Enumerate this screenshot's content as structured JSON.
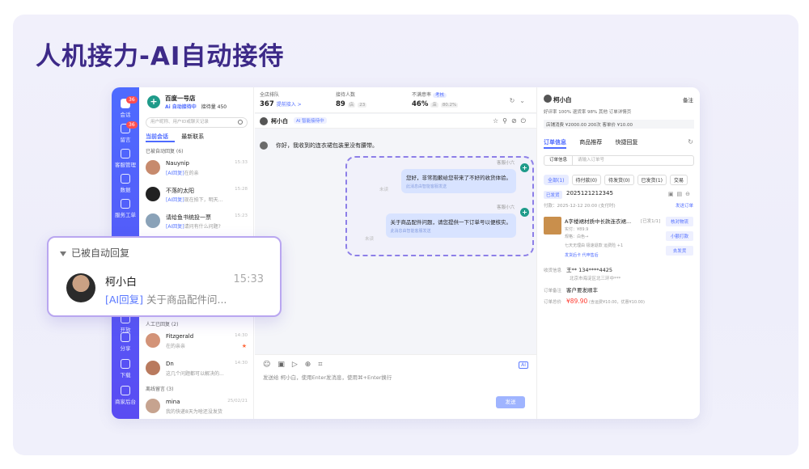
{
  "headline": "人机接力-AI自动接待",
  "rail": [
    {
      "label": "会话",
      "badge": "36",
      "icon": "chat-icon",
      "active": true
    },
    {
      "label": "留言",
      "badge": "36",
      "icon": "message-icon"
    },
    {
      "label": "客服管理",
      "icon": "agent-icon"
    },
    {
      "label": "数据",
      "icon": "chart-icon"
    },
    {
      "label": "服务工单",
      "icon": "ticket-icon"
    },
    {
      "label": "开放",
      "icon": "open-icon"
    },
    {
      "label": "分享",
      "icon": "share-icon"
    },
    {
      "label": "下载",
      "icon": "download-icon"
    },
    {
      "label": "商家后台",
      "icon": "home-icon"
    }
  ],
  "shop": {
    "name": "百度一号店",
    "ai_status": "Ai 自动接待中",
    "reception_label": "接待量",
    "reception_count": "450"
  },
  "list": {
    "search_placeholder": "用户昵称、用户ID或聊天记录",
    "tabs": [
      "当前会话",
      "最新联系"
    ],
    "group_auto": "已被自动回复 (6)",
    "group_manual": "人工已回复 (2)",
    "group_offline": "离线留言 (3)",
    "auto_items": [
      {
        "name": "Nauynip",
        "tag": "[AI回复]",
        "msg": "在的亲",
        "time": "15:33"
      },
      {
        "name": "不落的太阳",
        "tag": "[AI回复]",
        "msg": "现在拍下，明天...",
        "time": "15:28"
      },
      {
        "name": "请给鱼书统投一票",
        "tag": "[AI回复]",
        "msg": "请问有什么问题?",
        "time": "15:23"
      }
    ],
    "manual_items": [
      {
        "name": "Fitzgerald",
        "msg": "在的亲亲",
        "time": "14:30"
      },
      {
        "name": "Dn",
        "msg": "这几个问题都可以解决的...",
        "time": "14:30"
      }
    ],
    "offline_items": [
      {
        "name": "mina",
        "msg": "我的快递8天为啥还没发货",
        "time": "25/02/21"
      }
    ]
  },
  "stats": {
    "queue": {
      "label": "全店排队",
      "value": "367",
      "link": "提前接入 >"
    },
    "served": {
      "label": "接待人数",
      "value": "89",
      "sub1": "店",
      "sub2": "23"
    },
    "dissatisfied": {
      "label": "不满意率",
      "tag": "考核",
      "value": "46%",
      "sub1": "店",
      "sub2": "80.2%"
    }
  },
  "chat": {
    "customer_name": "柯小白",
    "ai_tag": "AI 智能接待中",
    "customer_msg": "你好，我收到的连衣裙包装里没有腰带。",
    "bot_name": "客服小六",
    "replies": [
      {
        "text": "您好，非常抱歉给您带来了不好的收货体验。",
        "note": "此消息由智能客服发送",
        "read": "未读"
      },
      {
        "text": "关于商品配件问题，请您提供一下订单号以便核实。",
        "note": "此消息由智能客服发送",
        "read": "未读"
      }
    ],
    "compose_placeholder": "发送给 柯小白，使用Enter发消息，使用⌘+Enter换行",
    "send_label": "发送",
    "ai_chip": "AI"
  },
  "side": {
    "name": "柯小白",
    "note_label": "备注",
    "metrics": "好评率 100%    退货率 98%    其他    订单详情页",
    "metrics2": "店铺消费 ¥2000.00   200次   客单价 ¥10.00",
    "tabs": [
      "订单信息",
      "商品推荐",
      "快捷回复"
    ],
    "order_select": "订单信息",
    "order_search_placeholder": "请输入订单号",
    "filters": [
      "全部(1)",
      "待付款(0)",
      "待发货(0)",
      "已发货(1)",
      "交易"
    ],
    "order_status": "已发货",
    "order_id": "2025121212345",
    "pay_time": "付款：2025-12-12 20:00 (支付时)",
    "product_title": "A字楼裙材质中长款连衣裙...",
    "product_count": "[已发1/1]",
    "product_price": "实付：¥89.9",
    "product_spec": "规格：白色→",
    "product_tags": "七天无理由   极速退款   运费险   +1",
    "product_links": "发货后卡   代申售后",
    "actions": [
      "核对物流",
      "小额打款",
      "去发货"
    ],
    "receiver_label": "收货信息",
    "receiver": "王** 134****4425",
    "address": "北京市海淀区北三环中***",
    "remark_label": "订单备注",
    "remark": "客户要发顺丰",
    "total_label": "订单总价",
    "total": "¥89.90",
    "total_note": "(含运费¥10.00，优惠¥10.00)",
    "send_order": "发送订单"
  },
  "popup": {
    "group": "已被自动回复",
    "name": "柯小白",
    "time": "15:33",
    "tag": "[AI回复]",
    "msg": "关于商品配件问..."
  }
}
